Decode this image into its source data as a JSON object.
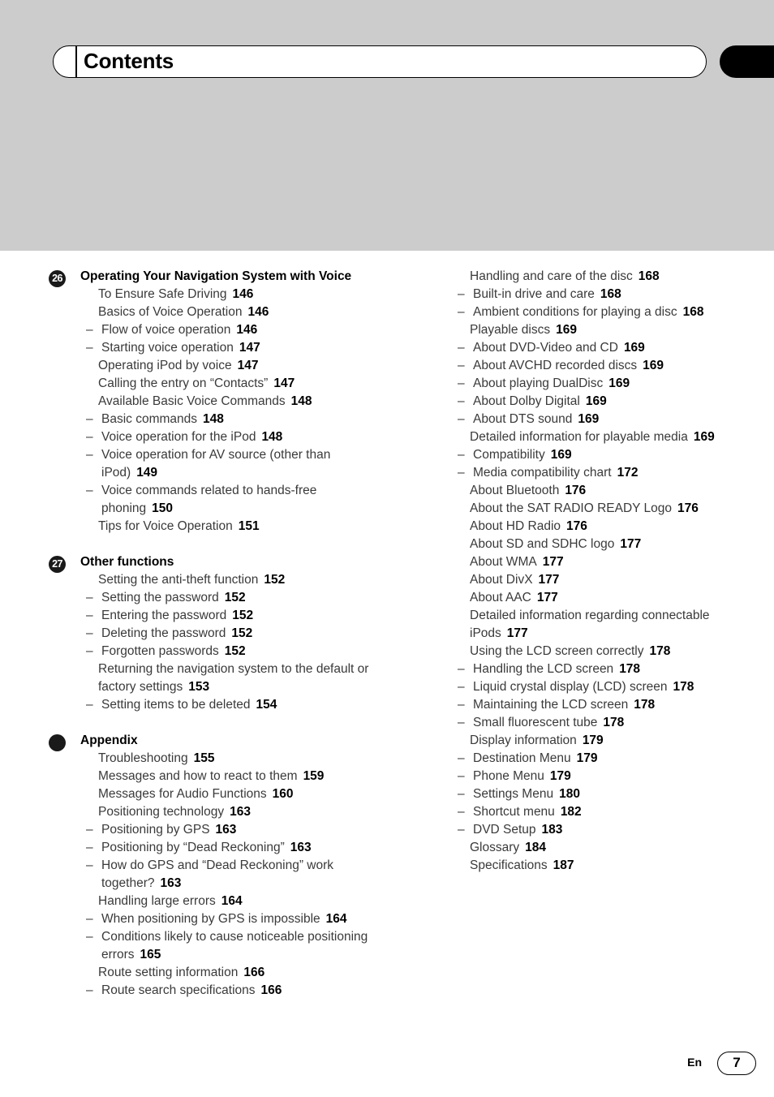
{
  "header": {
    "title": "Contents",
    "thumb_tab": ""
  },
  "footer": {
    "language": "En",
    "page_number": "7"
  },
  "toc": {
    "left_column": [
      {
        "badge": "26",
        "badge_type": "number",
        "heading": "Operating Your Navigation System with Voice",
        "entries": [
          {
            "level": 1,
            "text": "To Ensure Safe Driving",
            "page": "146"
          },
          {
            "level": 1,
            "text": "Basics of Voice Operation",
            "page": "146"
          },
          {
            "level": 2,
            "text": "Flow of voice operation",
            "page": "146"
          },
          {
            "level": 2,
            "text": "Starting voice operation",
            "page": "147"
          },
          {
            "level": 1,
            "text": "Operating iPod by voice",
            "page": "147"
          },
          {
            "level": 1,
            "text": "Calling the entry on “Contacts”",
            "page": "147"
          },
          {
            "level": 1,
            "text": "Available Basic Voice Commands",
            "page": "148"
          },
          {
            "level": 2,
            "text": "Basic commands",
            "page": "148"
          },
          {
            "level": 2,
            "text": "Voice operation for the iPod",
            "page": "148"
          },
          {
            "level": 2,
            "text": "Voice operation for AV source (other than iPod)",
            "page": "149"
          },
          {
            "level": 2,
            "text": "Voice commands related to hands-free phoning",
            "page": "150"
          },
          {
            "level": 1,
            "text": "Tips for Voice Operation",
            "page": "151"
          }
        ]
      },
      {
        "badge": "27",
        "badge_type": "number",
        "heading": "Other functions",
        "entries": [
          {
            "level": 1,
            "text": "Setting the anti-theft function",
            "page": "152"
          },
          {
            "level": 2,
            "text": "Setting the password",
            "page": "152"
          },
          {
            "level": 2,
            "text": "Entering the password",
            "page": "152"
          },
          {
            "level": 2,
            "text": "Deleting the password",
            "page": "152"
          },
          {
            "level": 2,
            "text": "Forgotten passwords",
            "page": "152"
          },
          {
            "level": 1,
            "text": "Returning the navigation system to the default or factory settings",
            "page": "153"
          },
          {
            "level": 2,
            "text": "Setting items to be deleted",
            "page": "154"
          }
        ]
      },
      {
        "badge": "",
        "badge_type": "dot",
        "heading": "Appendix",
        "entries": [
          {
            "level": 1,
            "text": "Troubleshooting",
            "page": "155"
          },
          {
            "level": 1,
            "text": "Messages and how to react to them",
            "page": "159"
          },
          {
            "level": 1,
            "text": "Messages for Audio Functions",
            "page": "160"
          },
          {
            "level": 1,
            "text": "Positioning technology",
            "page": "163"
          },
          {
            "level": 2,
            "text": "Positioning by GPS",
            "page": "163"
          },
          {
            "level": 2,
            "text": "Positioning by “Dead Reckoning”",
            "page": "163"
          },
          {
            "level": 2,
            "text": "How do GPS and “Dead Reckoning” work together?",
            "page": "163"
          },
          {
            "level": 1,
            "text": "Handling large errors",
            "page": "164"
          },
          {
            "level": 2,
            "text": "When positioning by GPS is impossible",
            "page": "164"
          },
          {
            "level": 2,
            "text": "Conditions likely to cause noticeable positioning errors",
            "page": "165"
          },
          {
            "level": 1,
            "text": "Route setting information",
            "page": "166"
          },
          {
            "level": 2,
            "text": "Route search specifications",
            "page": "166"
          }
        ]
      }
    ],
    "right_column": [
      {
        "badge": "",
        "badge_type": "none",
        "heading": "",
        "entries": [
          {
            "level": 1,
            "text": "Handling and care of the disc",
            "page": "168"
          },
          {
            "level": 2,
            "text": "Built-in drive and care",
            "page": "168"
          },
          {
            "level": 2,
            "text": "Ambient conditions for playing a disc",
            "page": "168"
          },
          {
            "level": 1,
            "text": "Playable discs",
            "page": "169"
          },
          {
            "level": 2,
            "text": "About DVD-Video and CD",
            "page": "169"
          },
          {
            "level": 2,
            "text": "About AVCHD recorded discs",
            "page": "169"
          },
          {
            "level": 2,
            "text": "About playing DualDisc",
            "page": "169"
          },
          {
            "level": 2,
            "text": "About Dolby Digital",
            "page": "169"
          },
          {
            "level": 2,
            "text": "About DTS sound",
            "page": "169"
          },
          {
            "level": 1,
            "text": "Detailed information for playable media",
            "page": "169"
          },
          {
            "level": 2,
            "text": "Compatibility",
            "page": "169"
          },
          {
            "level": 2,
            "text": "Media compatibility chart",
            "page": "172"
          },
          {
            "level": 1,
            "text": "About Bluetooth",
            "page": "176"
          },
          {
            "level": 1,
            "text": "About the SAT RADIO READY Logo",
            "page": "176"
          },
          {
            "level": 1,
            "text": "About HD Radio",
            "page": "176"
          },
          {
            "level": 1,
            "text": "About SD and SDHC logo",
            "page": "177"
          },
          {
            "level": 1,
            "text": "About WMA",
            "page": "177"
          },
          {
            "level": 1,
            "text": "About DivX",
            "page": "177"
          },
          {
            "level": 1,
            "text": "About AAC",
            "page": "177"
          },
          {
            "level": 1,
            "text": "Detailed information regarding connectable iPods",
            "page": "177"
          },
          {
            "level": 1,
            "text": "Using the LCD screen correctly",
            "page": "178"
          },
          {
            "level": 2,
            "text": "Handling the LCD screen",
            "page": "178"
          },
          {
            "level": 2,
            "text": "Liquid crystal display (LCD) screen",
            "page": "178"
          },
          {
            "level": 2,
            "text": "Maintaining the LCD screen",
            "page": "178"
          },
          {
            "level": 2,
            "text": "Small fluorescent tube",
            "page": "178"
          },
          {
            "level": 1,
            "text": "Display information",
            "page": "179"
          },
          {
            "level": 2,
            "text": "Destination Menu",
            "page": "179"
          },
          {
            "level": 2,
            "text": "Phone Menu",
            "page": "179"
          },
          {
            "level": 2,
            "text": "Settings Menu",
            "page": "180"
          },
          {
            "level": 2,
            "text": "Shortcut menu",
            "page": "182"
          },
          {
            "level": 2,
            "text": "DVD Setup",
            "page": "183"
          },
          {
            "level": 1,
            "text": "Glossary",
            "page": "184"
          },
          {
            "level": 1,
            "text": "Specifications",
            "page": "187"
          }
        ]
      }
    ]
  },
  "colors": {
    "band": "#cccccc",
    "text": "#3a3a3a",
    "page_number": "#000000",
    "badge": "#1a1a1a"
  }
}
